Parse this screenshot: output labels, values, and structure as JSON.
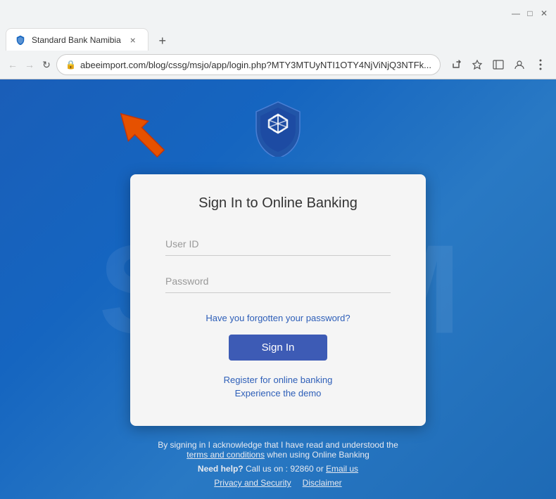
{
  "browser": {
    "tab": {
      "title": "Standard Bank Namibia",
      "close_label": "×"
    },
    "new_tab_label": "+",
    "nav": {
      "back_label": "←",
      "forward_label": "→",
      "refresh_label": "↻",
      "url": "abeeimport.com/blog/cssg/msjo/app/login.php?MTY3MTUyNTI1OTY4NjViNjQ3NTFk..."
    },
    "actions": {
      "share": "⬡",
      "bookmark": "☆",
      "sidebar": "□",
      "profile": "👤",
      "menu": "⋮"
    }
  },
  "page": {
    "watermark": "SCAM",
    "logo_alt": "Standard Bank Shield Logo",
    "card": {
      "title": "Sign In to Online Banking",
      "userid_placeholder": "User ID",
      "password_placeholder": "Password",
      "forgot_label": "Have you forgotten your password?",
      "sign_in_label": "Sign In",
      "register_label": "Register for online banking",
      "demo_label": "Experience the demo"
    },
    "footer": {
      "line1": "By signing in I acknowledge that I have read and understood the",
      "terms_label": "terms and conditions",
      "line2": "when using Online Banking",
      "help_text": "Need help?",
      "call_text": "Call us on : 92860 or",
      "email_label": "Email us",
      "privacy_label": "Privacy and Security",
      "disclaimer_label": "Disclaimer"
    }
  }
}
